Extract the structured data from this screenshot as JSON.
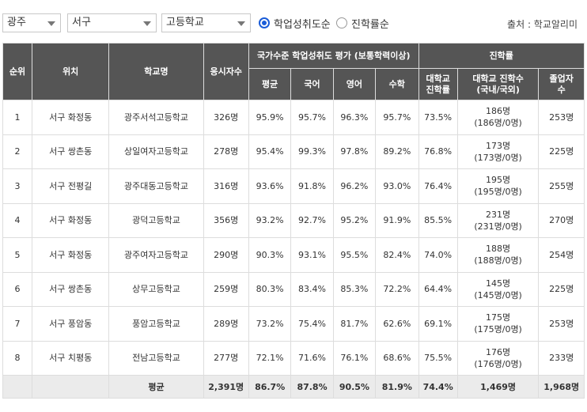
{
  "filters": {
    "region": "광주",
    "district": "서구",
    "school_type": "고등학교"
  },
  "sort": {
    "option1": "학업성취도순",
    "option2": "진학률순",
    "selected": "학업성취도순"
  },
  "source": "출처 : 학교알리미",
  "table": {
    "headers": {
      "rank": "순위",
      "location": "위치",
      "school": "학교명",
      "applicants": "응시자수",
      "achievement_group": "국가수준 학업성취도 평가 (보통학력이상)",
      "avg": "평균",
      "korean": "국어",
      "english": "영어",
      "math": "수학",
      "admission_group": "진학률",
      "univ_rate_1": "대학교",
      "univ_rate_2": "진학률",
      "univ_count_1": "대학교 진학수",
      "univ_count_2": "(국내/국외)",
      "grads_1": "졸업자",
      "grads_2": "수"
    },
    "rows": [
      {
        "rank": "1",
        "location": "서구 화정동",
        "school": "광주서석고등학교",
        "applicants": "326명",
        "avg": "95.9%",
        "korean": "95.7%",
        "english": "96.3%",
        "math": "95.7%",
        "univ_rate": "73.5%",
        "univ_count": "186명",
        "univ_split": "(186명/0명)",
        "grads": "253명"
      },
      {
        "rank": "2",
        "location": "서구 쌍촌동",
        "school": "상일여자고등학교",
        "applicants": "278명",
        "avg": "95.4%",
        "korean": "99.3%",
        "english": "97.8%",
        "math": "89.2%",
        "univ_rate": "76.8%",
        "univ_count": "173명",
        "univ_split": "(173명/0명)",
        "grads": "225명"
      },
      {
        "rank": "3",
        "location": "서구 전평길",
        "school": "광주대동고등학교",
        "applicants": "316명",
        "avg": "93.6%",
        "korean": "91.8%",
        "english": "96.2%",
        "math": "93.0%",
        "univ_rate": "76.4%",
        "univ_count": "195명",
        "univ_split": "(195명/0명)",
        "grads": "255명"
      },
      {
        "rank": "4",
        "location": "서구 화정동",
        "school": "광덕고등학교",
        "applicants": "356명",
        "avg": "93.2%",
        "korean": "92.7%",
        "english": "95.2%",
        "math": "91.9%",
        "univ_rate": "85.5%",
        "univ_count": "231명",
        "univ_split": "(231명/0명)",
        "grads": "270명"
      },
      {
        "rank": "5",
        "location": "서구 화정동",
        "school": "광주여자고등학교",
        "applicants": "290명",
        "avg": "90.3%",
        "korean": "93.1%",
        "english": "95.5%",
        "math": "82.4%",
        "univ_rate": "74.0%",
        "univ_count": "188명",
        "univ_split": "(188명/0명)",
        "grads": "254명"
      },
      {
        "rank": "6",
        "location": "서구 쌍촌동",
        "school": "상무고등학교",
        "applicants": "259명",
        "avg": "80.3%",
        "korean": "83.4%",
        "english": "85.3%",
        "math": "72.2%",
        "univ_rate": "64.4%",
        "univ_count": "145명",
        "univ_split": "(145명/0명)",
        "grads": "225명"
      },
      {
        "rank": "7",
        "location": "서구 풍암동",
        "school": "풍암고등학교",
        "applicants": "289명",
        "avg": "73.2%",
        "korean": "75.4%",
        "english": "81.7%",
        "math": "62.6%",
        "univ_rate": "69.1%",
        "univ_count": "175명",
        "univ_split": "(175명/0명)",
        "grads": "253명"
      },
      {
        "rank": "8",
        "location": "서구 치평동",
        "school": "전남고등학교",
        "applicants": "277명",
        "avg": "72.1%",
        "korean": "71.6%",
        "english": "76.1%",
        "math": "68.6%",
        "univ_rate": "75.5%",
        "univ_count": "176명",
        "univ_split": "(176명/0명)",
        "grads": "233명"
      }
    ],
    "average": {
      "label": "평균",
      "applicants": "2,391명",
      "avg": "86.7%",
      "korean": "87.8%",
      "english": "90.5%",
      "math": "81.9%",
      "univ_rate": "74.4%",
      "univ_count": "1,469명",
      "grads": "1,968명"
    }
  }
}
